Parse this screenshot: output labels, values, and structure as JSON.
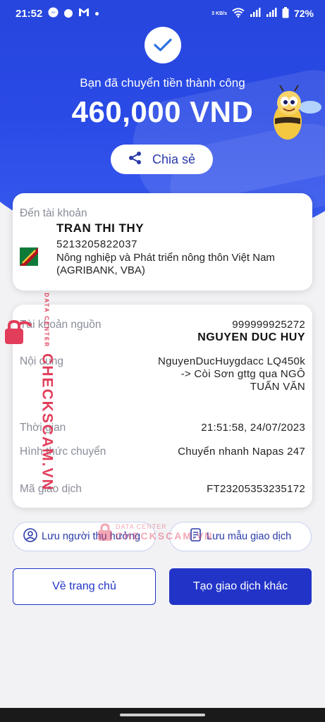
{
  "status_bar": {
    "time": "21:52",
    "speed": "3 KB/s",
    "battery": "72%",
    "icons": [
      "messenger-icon",
      "circle-icon",
      "gmail-icon",
      "notification-dot-icon",
      "wifi-icon",
      "signal-icon",
      "battery-icon"
    ]
  },
  "hero": {
    "success_text": "Bạn đã chuyển tiền thành công",
    "amount": "460,000 VND",
    "share_label": "Chia sẻ",
    "accent": "#2342d6"
  },
  "recipient": {
    "label": "Đến tài khoản",
    "name": "TRAN THI THY",
    "account": "5213205822037",
    "bank": "Nông nghiệp và Phát triển nông thôn Việt Nam (AGRIBANK, VBA)"
  },
  "details": {
    "source_label": "Tài khoản nguồn",
    "source_account": "999999925272",
    "source_name": "NGUYEN DUC HUY",
    "content_label": "Nội dung",
    "content_value": "NguyenDucHuygdacc LQ450k -> Còi Sơn gttg qua NGÔ TUẤN VĂN",
    "time_label": "Thời gian",
    "time_value": "21:51:58, 24/07/2023",
    "method_label": "Hình thức chuyển",
    "method_value": "Chuyển nhanh Napas 247",
    "txn_label": "Mã giao dịch",
    "txn_value": "FT23205353235172"
  },
  "actions": {
    "save_payee": "Lưu người thụ hưởng",
    "save_template": "Lưu mẫu giao dịch",
    "home": "Về trang chủ",
    "new_transaction": "Tạo giao dịch khác"
  },
  "watermark": {
    "brand": "CHECKSCAM.VN",
    "sub": "DATA CENTER",
    "color": "#e23d5a"
  }
}
